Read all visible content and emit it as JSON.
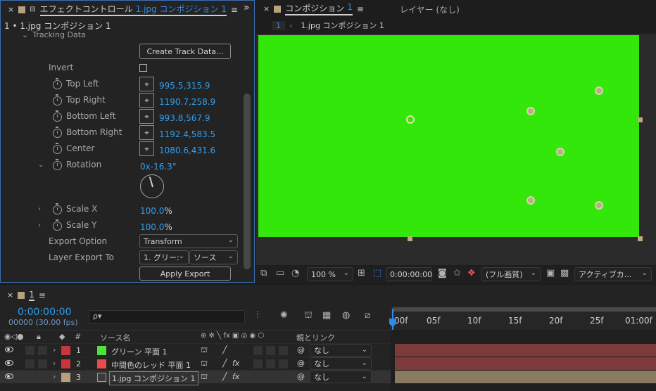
{
  "effect_panel": {
    "tab_close": "×",
    "tab_lock": "🔓",
    "tab_title": "エフェクトコントロール",
    "tab_comp": "1.jpg コンポジション 1",
    "tab_menu": "≡",
    "expand": "»",
    "layer_path": "1 • 1.jpg コンポジション 1",
    "tracking_data_label": "Tracking Data",
    "create_button": "Create Track Data...",
    "invert_label": "Invert",
    "points": [
      {
        "label": "Top Left",
        "value": "995.5,315.9"
      },
      {
        "label": "Top Right",
        "value": "1190.7,258.9"
      },
      {
        "label": "Bottom Left",
        "value": "993.8,567.9"
      },
      {
        "label": "Bottom Right",
        "value": "1192.4,583.5"
      },
      {
        "label": "Center",
        "value": "1080.6,431.6"
      }
    ],
    "rotation_label": "Rotation",
    "rotation_value": "0x-16.3°",
    "rotation_degrees": -16.3,
    "scale_x_label": "Scale X",
    "scale_x_value": "100.0",
    "scale_y_label": "Scale Y",
    "scale_y_value": "100.0",
    "percent": "%",
    "export_option_label": "Export Option",
    "export_option_value": "Transform",
    "layer_export_label": "Layer Export To",
    "layer_export_value1": "1. グリー:",
    "layer_export_value2": "ソース",
    "apply_button": "Apply Export",
    "target_glyph": "⌖"
  },
  "comp_panel": {
    "tab_close": "×",
    "tab_title": "コンポジション",
    "tab_num": "1",
    "tab_menu": "≡",
    "layer_tab": "レイヤー (なし)",
    "sub_tab_num": "1",
    "sub_tab_arrow": "‹",
    "sub_tab_title": "1.jpg コンポジション 1",
    "canvas_color": "#33e70b",
    "zoom": "100 %",
    "timecode": "0:00:00:00",
    "quality": "(フル画質)",
    "camera": "アクティブカ..."
  },
  "timeline": {
    "tab_close": "×",
    "tab_num": "1",
    "tab_menu": "≡",
    "timecode": "0:00:00:00",
    "frames": "00000 (30.00 fps)",
    "search_glyph": "ρ▾",
    "col_num": "#",
    "col_source": "ソース名",
    "col_parent": "親とリンク",
    "switch_headers": "⊕ ✲ ╲ fx ▣ ◎ ◉ ⬡",
    "ruler": [
      "00f",
      "05f",
      "10f",
      "15f",
      "20f",
      "25f",
      "01:00f"
    ],
    "layers": [
      {
        "num": "1",
        "label_color": "#c9353a",
        "swatch": "#4ee33a",
        "name": "グリーン 平面 1",
        "fx": "",
        "parent": "なし",
        "bar_color": "#7d3a3b"
      },
      {
        "num": "2",
        "label_color": "#c9353a",
        "swatch": "#e84b4b",
        "name": "中間色のレッド 平面 1",
        "fx": "fx",
        "parent": "なし",
        "bar_color": "#7d3a3b"
      },
      {
        "num": "3",
        "label_color": "#b89e7a",
        "swatch": "#6b6b6b",
        "name": "1.jpg コンポジション 1",
        "fx": "fx",
        "parent": "なし",
        "bar_color": "#8a7a5f"
      }
    ]
  }
}
